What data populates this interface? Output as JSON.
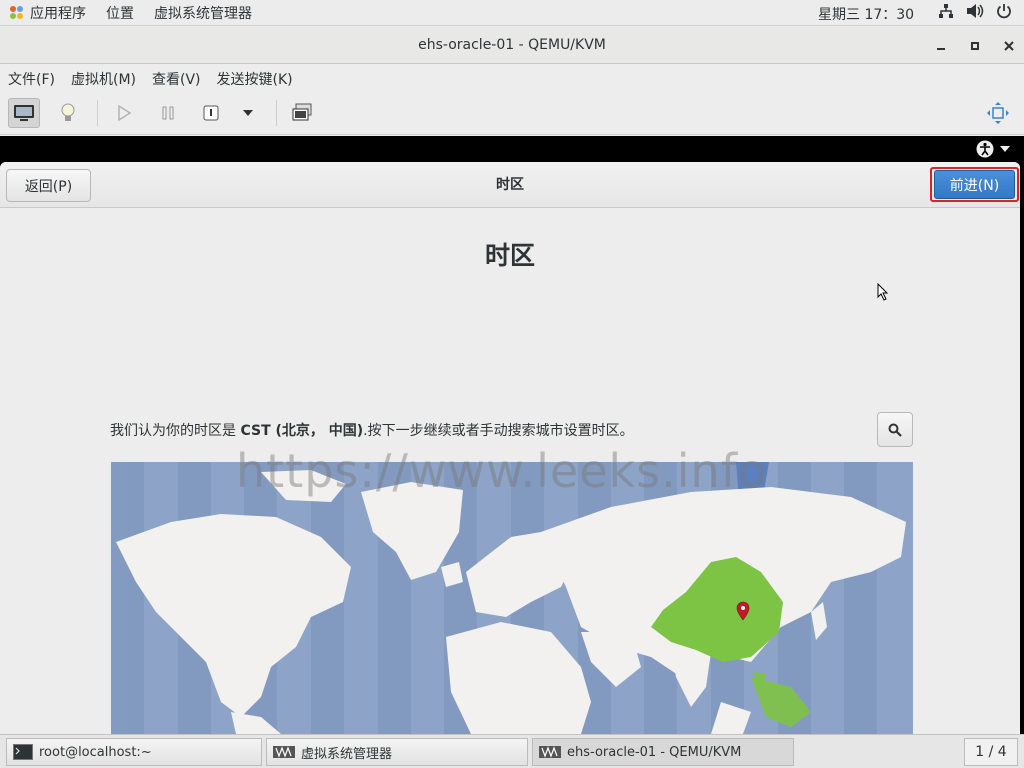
{
  "topbar": {
    "apps_menu": "应用程序",
    "places_menu": "位置",
    "app_title": "虚拟系统管理器",
    "clock": "星期三 17：30"
  },
  "window": {
    "title": "ehs-oracle-01 - QEMU/KVM"
  },
  "menubar": {
    "items": [
      "文件(F)",
      "虚拟机(M)",
      "查看(V)",
      "发送按键(K)"
    ]
  },
  "installer": {
    "back_label": "返回(P)",
    "header_title": "时区",
    "next_label": "前进(N)",
    "page_title": "时区",
    "hint_prefix": "我们认为你的时区是 ",
    "hint_zone": "CST (北京，  中国)",
    "hint_suffix": ".按下一步继续或者手动搜索城市设置时区。",
    "map_selected_region": "中国"
  },
  "watermark": "https://www.leeks.info",
  "taskbar": {
    "tasks": [
      "root@localhost:~",
      "虚拟系统管理器",
      "ehs-oracle-01 - QEMU/KVM"
    ],
    "pager": "1 / 4"
  },
  "colors": {
    "accent": "#3d84d2",
    "highlight": "#dd2222",
    "map_water": "#8da4c8",
    "map_land": "#f2f1ef",
    "map_selected": "#7dc344"
  }
}
